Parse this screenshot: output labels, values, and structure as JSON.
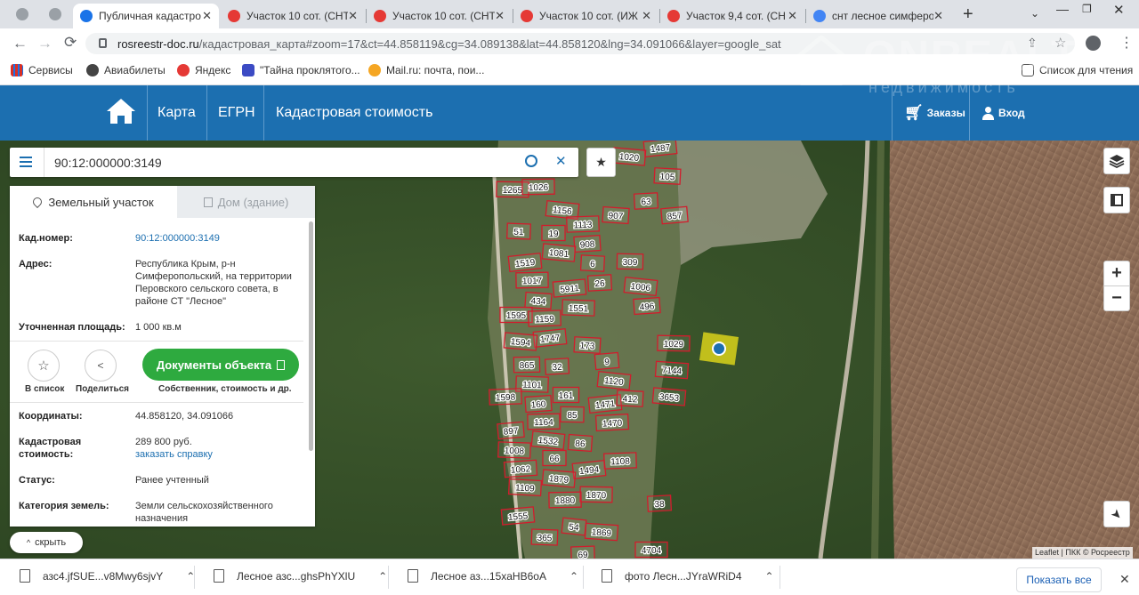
{
  "browser": {
    "tabs": [
      {
        "title": "Публичная кадастро",
        "active": true,
        "favicon_color": "#1a73e8"
      },
      {
        "title": "Участок 10 сот. (СНТ",
        "active": false,
        "favicon_color": "#e53935"
      },
      {
        "title": "Участок 10 сот. (СНТ",
        "active": false,
        "favicon_color": "#e53935"
      },
      {
        "title": "Участок 10 сот. (ИЖ",
        "active": false,
        "favicon_color": "#e53935"
      },
      {
        "title": "Участок 9,4 сот. (СН",
        "active": false,
        "favicon_color": "#e53935"
      },
      {
        "title": "снт лесное симферо",
        "active": false,
        "favicon_color": "#4285f4"
      }
    ],
    "url_domain": "rosreestr-doc.ru",
    "url_path": "/кадастровая_карта#zoom=17&ct=44.858119&cg=34.089138&lat=44.858120&lng=34.091066&layer=google_sat",
    "bookmarks": [
      {
        "label": "Сервисы",
        "icon": "apps-grid-icon"
      },
      {
        "label": "Авиабилеты",
        "icon": "globe-icon"
      },
      {
        "label": "Яндекс",
        "icon": "yandex-icon"
      },
      {
        "label": "\"Тайна проклятого...",
        "icon": "bookmark-icon"
      },
      {
        "label": "Mail.ru: почта, пои...",
        "icon": "mail-icon"
      }
    ],
    "reading_list": "Список для чтения"
  },
  "site": {
    "nav": [
      "Карта",
      "ЕГРН",
      "Кадастровая стоимость"
    ],
    "orders": "Заказы",
    "login": "Вход",
    "watermark_top": "ONREALT",
    "watermark_bottom": "недвижимость"
  },
  "search": {
    "value": "90:12:000000:3149"
  },
  "panel": {
    "tab_land": "Земельный участок",
    "tab_house": "Дом (здание)",
    "rows": [
      {
        "label": "Кад.номер:",
        "value": "90:12:000000:3149"
      },
      {
        "label": "Адрес:",
        "value": "Республика Крым, р-н Симферопольский, на территории Перовского сельского совета, в районе СТ \"Лесное\""
      },
      {
        "label": "Уточненная площадь:",
        "value": "1 000 кв.м"
      }
    ],
    "actions": {
      "add_list": "В список",
      "share": "Поделиться",
      "documents_button": "Документы объекта",
      "documents_sub": "Собственник, стоимость и др."
    },
    "rows2": [
      {
        "label": "Координаты:",
        "value": "44.858120, 34.091066"
      },
      {
        "label": "Кадастровая стоимость:",
        "value": "289 800 руб.",
        "link": "заказать справку"
      },
      {
        "label": "Статус:",
        "value": "Ранее учтенный"
      },
      {
        "label": "Категория земель:",
        "value": "Земли сельскохозяйственного назначения"
      }
    ],
    "hide": "скрыть"
  },
  "map": {
    "plots": [
      "1487",
      "1020",
      "105",
      "1265",
      "1026",
      "63",
      "857",
      "1156",
      "907",
      "51",
      "19",
      "1113",
      "908",
      "1519",
      "1081",
      "6",
      "309",
      "1017",
      "26",
      "5911",
      "1006",
      "434",
      "1551",
      "1595",
      "1159",
      "496",
      "1747",
      "1594",
      "173",
      "1029",
      "865",
      "32",
      "9",
      "1120",
      "7144",
      "1101",
      "161",
      "1598",
      "160",
      "1471",
      "3653",
      "412",
      "85",
      "1164",
      "1470",
      "897",
      "1532",
      "86",
      "1008",
      "66",
      "1108",
      "1062",
      "1494",
      "1879",
      "1109",
      "1870",
      "1880",
      "38",
      "1555",
      "54",
      "1869",
      "365",
      "4704",
      "69"
    ],
    "attribution": "Leaflet | ПКК © Росреестр",
    "zoom_in": "+",
    "zoom_out": "−"
  },
  "downloads": {
    "items": [
      "азс4.jfSUE...v8Mwy6sjvY",
      "Лесное азс...ghsPhYXlU",
      "Лесное аз...15xaHB6oA",
      "фото Лесн...JYraWRiD4"
    ],
    "show_all": "Показать все"
  },
  "colors": {
    "header": "#1c6fb0",
    "green_button": "#2eaa3f",
    "plot_border": "#d11c2c",
    "link": "#1c6fb0"
  }
}
